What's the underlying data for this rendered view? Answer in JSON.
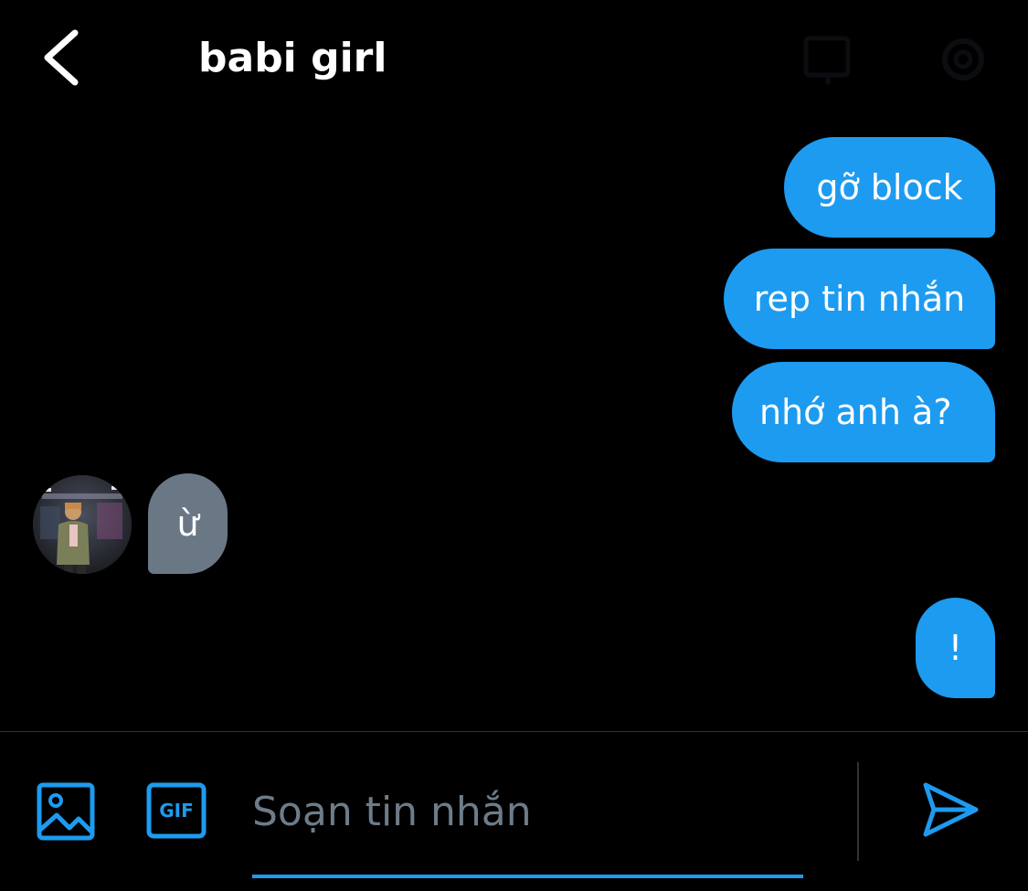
{
  "header": {
    "title": "babi girl",
    "back_icon": "chevron-left-icon",
    "info_icon": "info-icon",
    "settings_icon": "gear-icon"
  },
  "messages": [
    {
      "sender": "me",
      "text": "gỡ block"
    },
    {
      "sender": "me",
      "text": "rep tin nhắn"
    },
    {
      "sender": "me",
      "text": "nhớ anh à?"
    },
    {
      "sender": "other",
      "text": "ừ"
    },
    {
      "sender": "me",
      "text": "!"
    }
  ],
  "composer": {
    "placeholder": "Soạn tin nhắn",
    "image_icon": "image-icon",
    "gif_label": "GIF",
    "send_icon": "send-icon"
  },
  "colors": {
    "background": "#000000",
    "sent_bubble": "#1d9bf0",
    "received_bubble": "#6a7886",
    "accent": "#1d9bf0",
    "placeholder": "#6e7c89"
  }
}
